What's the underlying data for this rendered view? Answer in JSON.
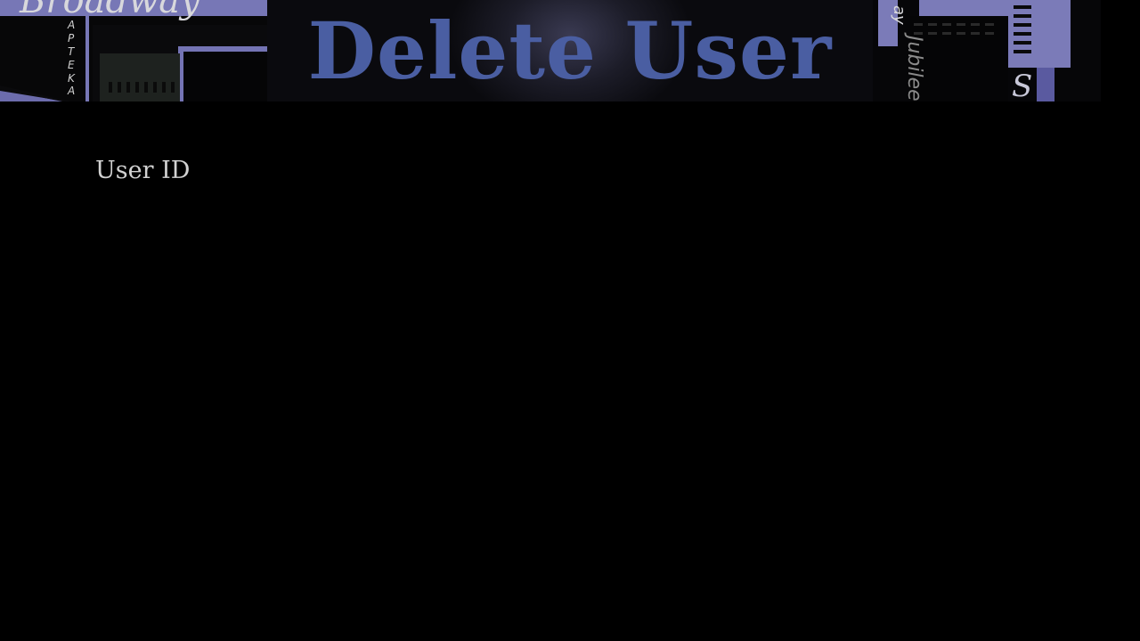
{
  "page": {
    "title": "Delete User"
  },
  "banner": {
    "left_script_text": "Broadway",
    "left_vertical_text": "APTEKA",
    "right_vertical_script": "Jubilee"
  },
  "form": {
    "user_id_label": "User ID"
  },
  "colors": {
    "background": "#000000",
    "title": "#4a5ea2",
    "label": "#d2d2d2",
    "accent_purple": "#7f7fc0"
  }
}
